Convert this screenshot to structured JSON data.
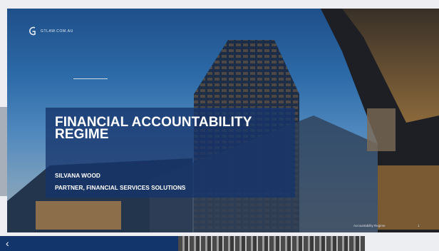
{
  "slide": {
    "logo_text": "GTLAW.COM.AU",
    "title_line1": "FINANCIAL ACCOUNTABILITY",
    "title_line2": "REGIME",
    "presenter_name": "SILVANA WOOD",
    "presenter_role": "PARTNER, FINANCIAL SERVICES SOLUTIONS",
    "footer_title": "Accountability Regime",
    "page_number": "1"
  },
  "next_slide": {
    "chevron_icon": "chevron-left-icon"
  },
  "colors": {
    "panel": "#16346b",
    "sky": "#2c6aa8",
    "text": "#ffffff"
  }
}
